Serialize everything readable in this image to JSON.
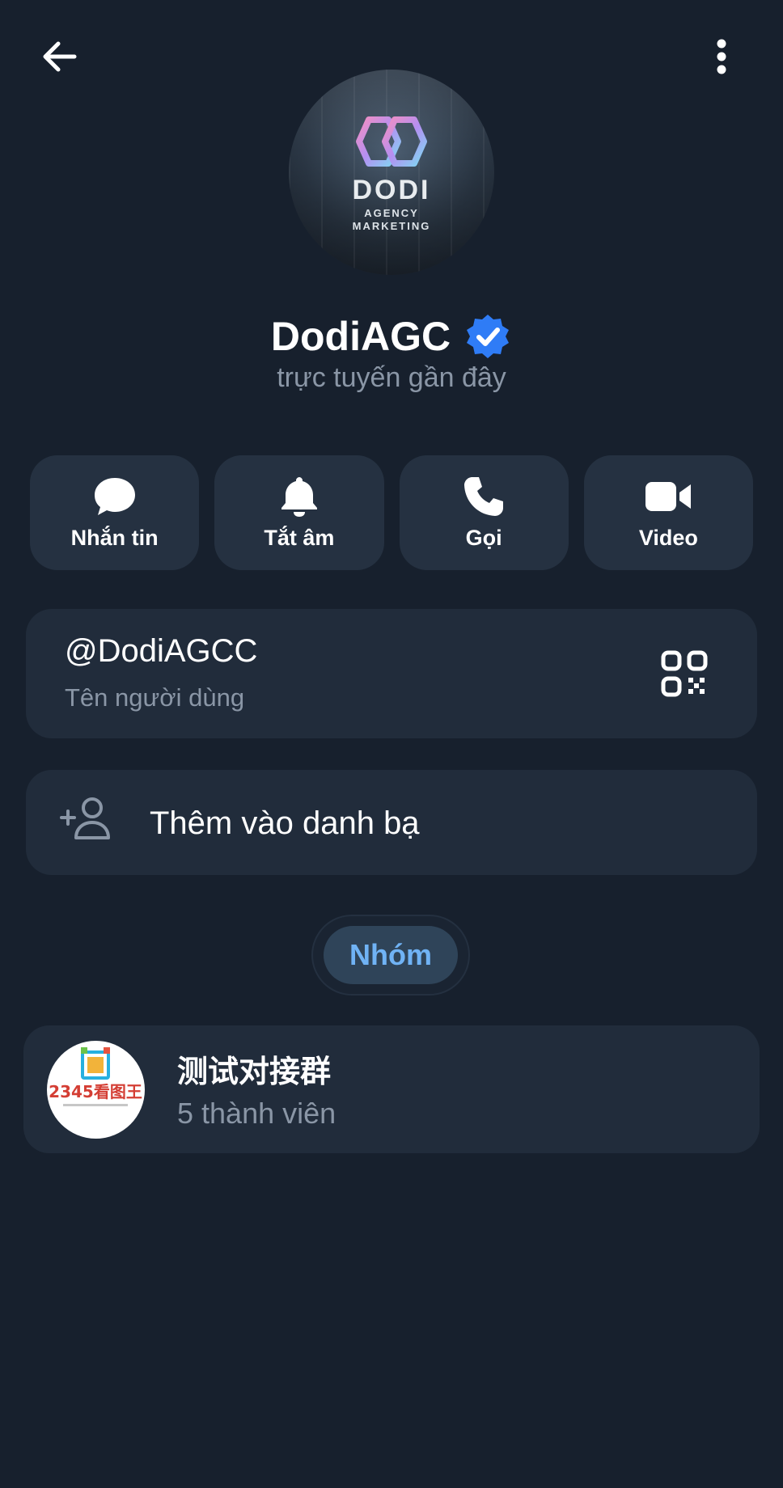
{
  "header": {
    "back_icon": "arrow-left-icon",
    "menu_icon": "more-vertical-icon"
  },
  "profile": {
    "avatar_text": "DODI",
    "avatar_sub1": "AGENCY",
    "avatar_sub2": "MARKETING",
    "name": "DodiAGC",
    "verified_icon": "verified-badge-icon",
    "status": "trực tuyến gần đây"
  },
  "actions": [
    {
      "label": "Nhắn tin",
      "icon": "chat-bubble-icon"
    },
    {
      "label": "Tắt âm",
      "icon": "bell-icon"
    },
    {
      "label": "Gọi",
      "icon": "phone-icon"
    },
    {
      "label": "Video",
      "icon": "video-camera-icon"
    }
  ],
  "username": {
    "value": "@DodiAGCC",
    "caption": "Tên người dùng",
    "qr_icon": "qr-code-icon"
  },
  "contact": {
    "label": "Thêm vào danh bạ",
    "icon": "add-person-icon"
  },
  "tabs": [
    {
      "label": "Nhóm",
      "selected": true
    }
  ],
  "groups": [
    {
      "name": "测试对接群",
      "members": "5 thành viên",
      "avatar_text": "2345看图王"
    }
  ],
  "colors": {
    "background": "#17202d",
    "card": "#212c3b",
    "accent": "#70b3f5",
    "verified": "#2f7cf6",
    "muted_text": "#8a96a6"
  }
}
